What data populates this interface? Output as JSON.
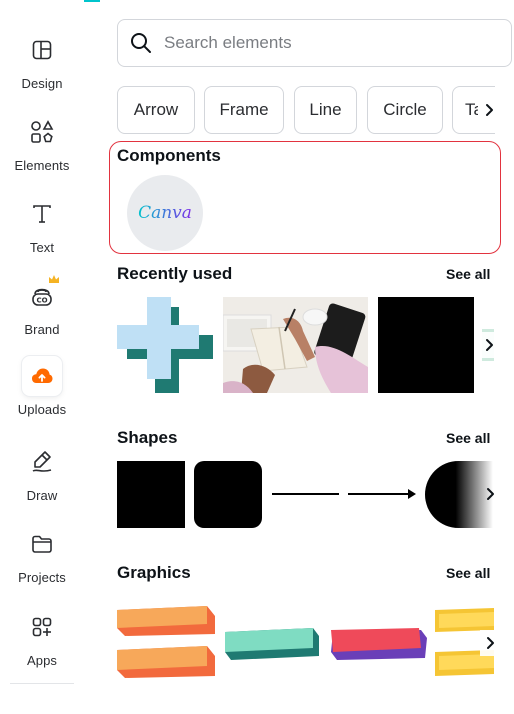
{
  "rail": {
    "items": [
      {
        "label": "Design",
        "icon": "layout-icon"
      },
      {
        "label": "Elements",
        "icon": "shapes-icon"
      },
      {
        "label": "Text",
        "icon": "text-icon"
      },
      {
        "label": "Brand",
        "icon": "brand-icon"
      },
      {
        "label": "Uploads",
        "icon": "cloud-upload-icon"
      },
      {
        "label": "Draw",
        "icon": "pen-icon"
      },
      {
        "label": "Projects",
        "icon": "folder-icon"
      },
      {
        "label": "Apps",
        "icon": "apps-icon"
      }
    ]
  },
  "search": {
    "placeholder": "Search elements",
    "value": ""
  },
  "chips": [
    "Arrow",
    "Frame",
    "Line",
    "Circle",
    "Ta"
  ],
  "components": {
    "title": "Components",
    "badge_text": "Canva"
  },
  "recently_used": {
    "title": "Recently used",
    "see_all": "See all"
  },
  "shapes": {
    "title": "Shapes",
    "see_all": "See all"
  },
  "graphics": {
    "title": "Graphics",
    "see_all": "See all"
  },
  "colors": {
    "accent": "#00c4cc",
    "highlight": "#e2333f",
    "upload_orange": "#ff6a00",
    "crown": "#f5b324"
  }
}
